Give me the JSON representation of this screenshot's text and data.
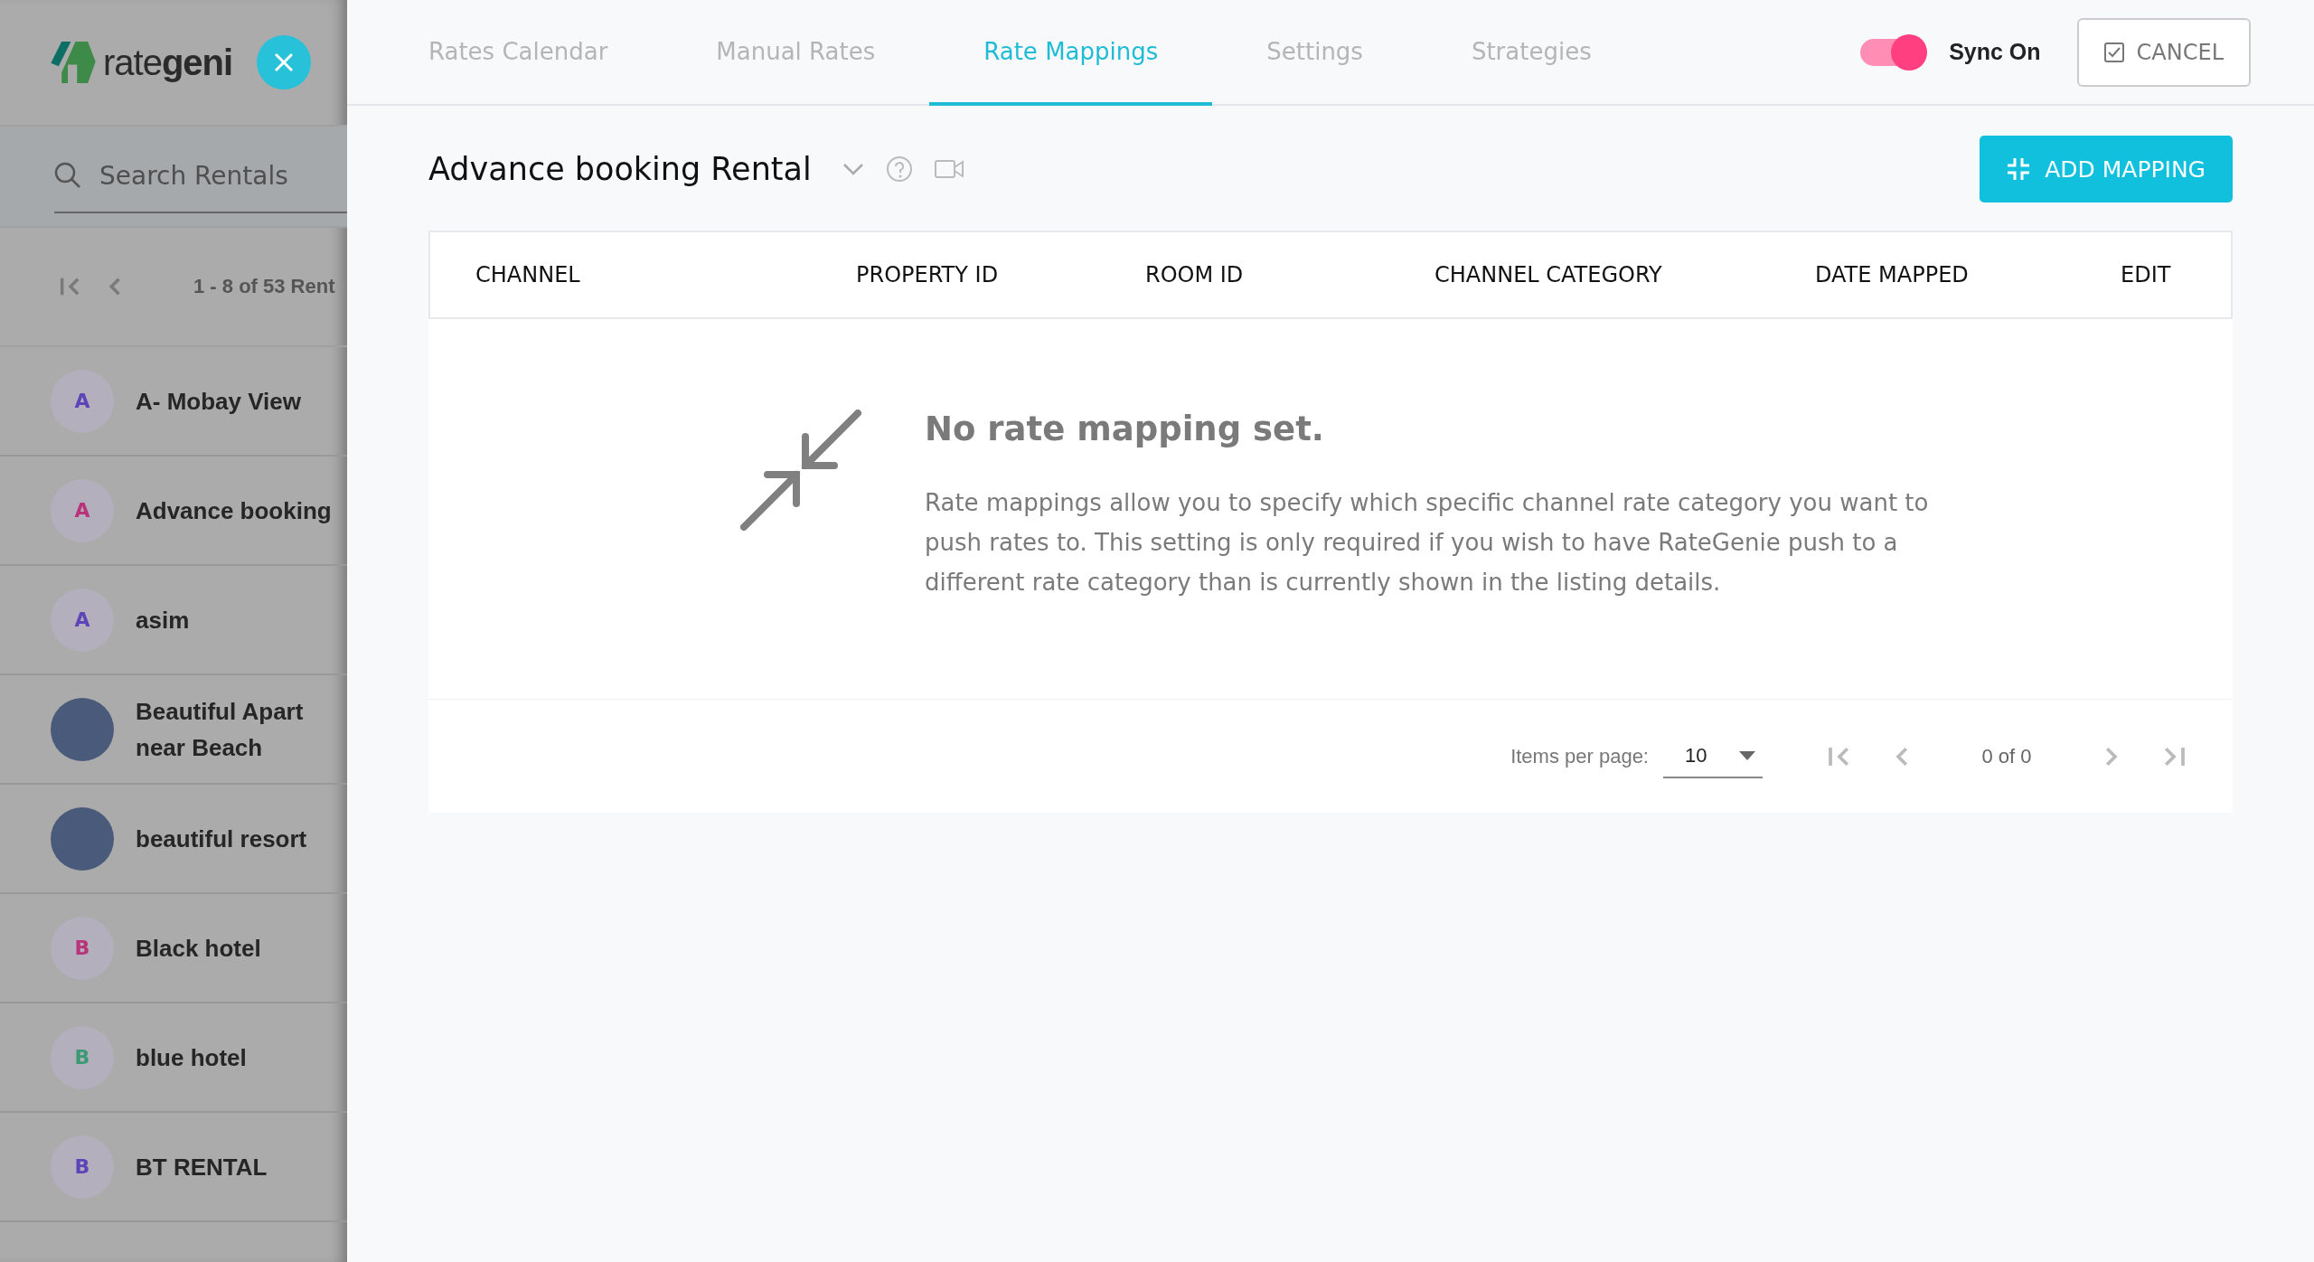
{
  "sidebar": {
    "logo": "rate**geni**",
    "search": {
      "placeholder": "Search Rentals"
    },
    "range": "1 - 8 of 53 Rent",
    "rentals": [
      {
        "kind": "letter",
        "initial": "A",
        "color": "#5b45b8",
        "name": "A- Mobay View"
      },
      {
        "kind": "letter",
        "initial": "A",
        "color": "#b8337a",
        "name": "Advance booking"
      },
      {
        "kind": "letter",
        "initial": "A",
        "color": "#5b45b8",
        "name": "asim"
      },
      {
        "kind": "photo",
        "name": "Beautiful Apart\nnear Beach"
      },
      {
        "kind": "photo",
        "name": "beautiful resort"
      },
      {
        "kind": "letter",
        "initial": "B",
        "color": "#b8337a",
        "name": "Black hotel"
      },
      {
        "kind": "letter",
        "initial": "B",
        "color": "#3a9a72",
        "name": "blue hotel"
      },
      {
        "kind": "letter",
        "initial": "B",
        "color": "#5b45b8",
        "name": "BT RENTAL"
      }
    ]
  },
  "tabs": [
    {
      "label": "Rates Calendar",
      "selected": false
    },
    {
      "label": "Manual Rates",
      "selected": false
    },
    {
      "label": "Rate Mappings",
      "selected": true
    },
    {
      "label": "Settings",
      "selected": false
    },
    {
      "label": "Strategies",
      "selected": false
    }
  ],
  "sync": {
    "label": "Sync On",
    "on": true
  },
  "cancel_button": "CANCEL",
  "rental_title": "Advance booking Rental",
  "add_button": "ADD MAPPING",
  "table": {
    "columns": [
      "CHANNEL",
      "PROPERTY ID",
      "ROOM ID",
      "CHANNEL CATEGORY",
      "DATE MAPPED",
      "EDIT"
    ]
  },
  "empty_state": {
    "title": "No rate mapping set.",
    "text": "Rate mappings allow you to specify which specific channel rate category you want to push rates to. This setting is only required if you wish to have RateGenie push to a different rate category than is currently shown in the listing details."
  },
  "paginator": {
    "label": "Items per page:",
    "page_size": "10",
    "range": "0 of 0"
  }
}
